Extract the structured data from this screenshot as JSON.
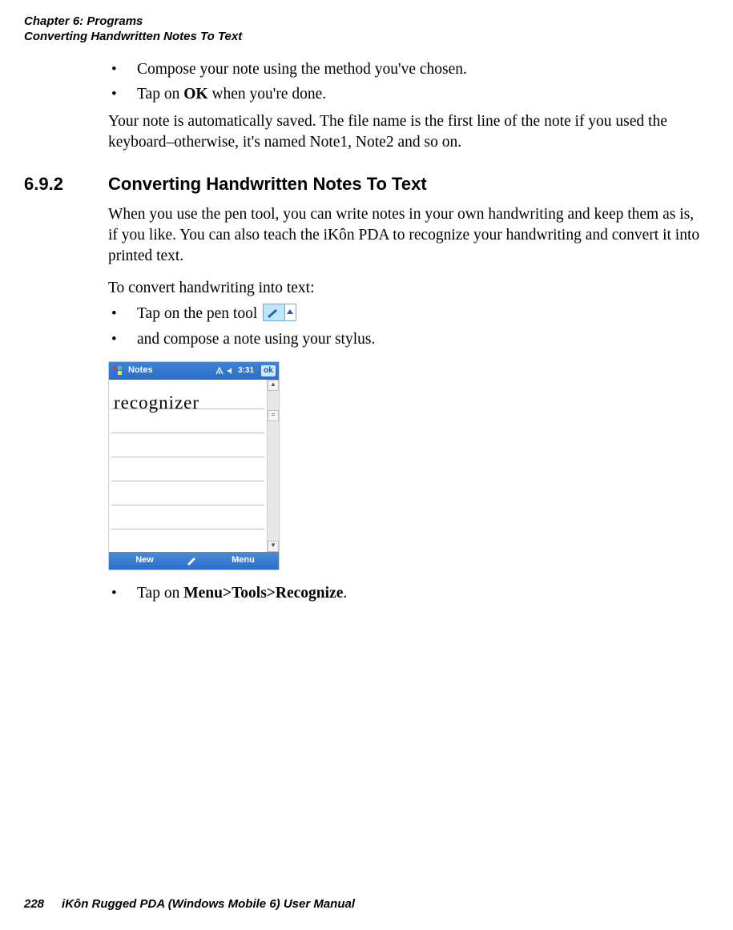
{
  "header": {
    "chapter": "Chapter 6: Programs",
    "section": "Converting Handwritten Notes To Text"
  },
  "intro_bullets": [
    {
      "pre": "Compose your note using the method you've chosen."
    },
    {
      "pre": "Tap on ",
      "bold": "OK",
      "post": " when you're done."
    }
  ],
  "intro_para": "Your note is automatically saved. The file name is the first line of the note if you used the keyboard–otherwise, it's named Note1, Note2 and so on.",
  "section": {
    "number": "6.9.2",
    "title": "Converting Handwritten Notes To Text"
  },
  "body_para1": "When you use the pen tool, you can write notes in your own handwriting and keep them as is, if you like. You can also teach the iKôn PDA to recognize your handwriting and convert it into printed text.",
  "body_para2": "To convert handwriting into text:",
  "steps": [
    {
      "pre": "Tap on the pen tool ",
      "icon": "pen-tool-icon"
    },
    {
      "pre": " and compose a note using your stylus."
    }
  ],
  "device": {
    "app_title": "Notes",
    "time": "3:31",
    "ok": "ok",
    "handwriting_text": "recognizer",
    "softkey_left": "New",
    "softkey_right": "Menu"
  },
  "final_bullet": {
    "pre": "Tap on ",
    "bold": "Menu>Tools>Recognize",
    "post": "."
  },
  "footer": {
    "page": "228",
    "manual": "iKôn Rugged PDA (Windows Mobile 6) User Manual"
  }
}
